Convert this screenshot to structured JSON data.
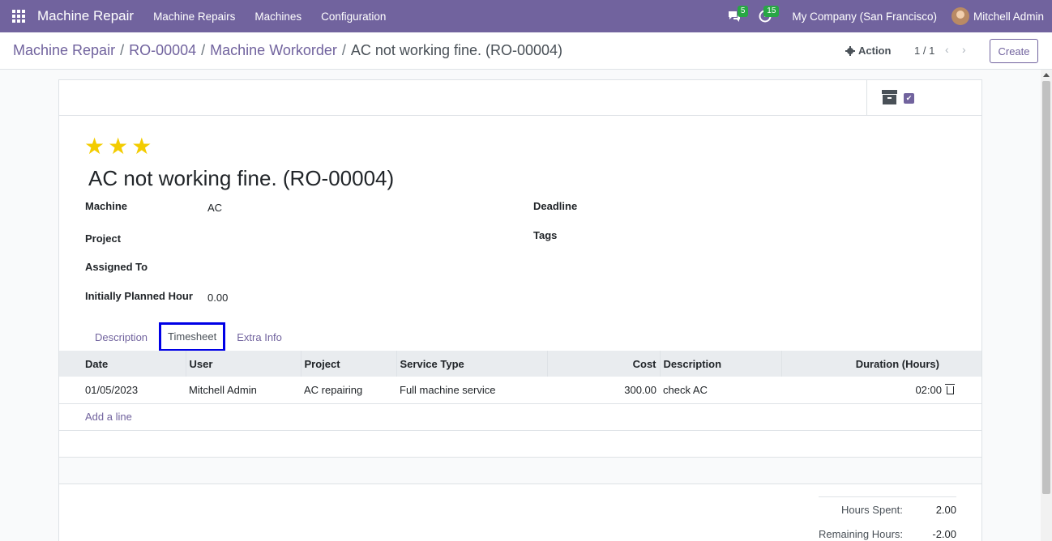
{
  "navbar": {
    "app_title": "Machine Repair",
    "menus": [
      "Machine Repairs",
      "Machines",
      "Configuration"
    ],
    "messages_count": "5",
    "activities_count": "15",
    "company": "My Company (San Francisco)",
    "user": "Mitchell Admin",
    "brand_color": "#71639e"
  },
  "control_panel": {
    "breadcrumbs": [
      "Machine Repair",
      "RO-00004",
      "Machine Workorder",
      "AC not working fine. (RO-00004)"
    ],
    "action_label": "Action",
    "pager": "1 / 1",
    "create_label": "Create"
  },
  "form": {
    "priority_stars": 3,
    "title": "AC not working fine. (RO-00004)",
    "fields": {
      "machine_label": "Machine",
      "machine_value": "AC",
      "project_label": "Project",
      "project_value": "",
      "assigned_label": "Assigned To",
      "assigned_value": "",
      "planned_label": "Initially Planned Hour",
      "planned_value": "0.00",
      "deadline_label": "Deadline",
      "deadline_value": "",
      "tags_label": "Tags",
      "tags_value": ""
    },
    "tabs": [
      "Description",
      "Timesheet",
      "Extra Info"
    ],
    "active_tab": "Timesheet"
  },
  "timesheet": {
    "columns": [
      "Date",
      "User",
      "Project",
      "Service Type",
      "Cost",
      "Description",
      "Duration (Hours)"
    ],
    "rows": [
      {
        "date": "01/05/2023",
        "user": "Mitchell Admin",
        "project": "AC repairing",
        "service_type": "Full machine service",
        "cost": "300.00",
        "description": "check AC",
        "duration": "02:00"
      }
    ],
    "add_line": "Add a line"
  },
  "totals": {
    "hours_spent_label": "Hours Spent:",
    "hours_spent": "2.00",
    "remaining_label": "Remaining Hours:",
    "remaining": "-2.00"
  }
}
